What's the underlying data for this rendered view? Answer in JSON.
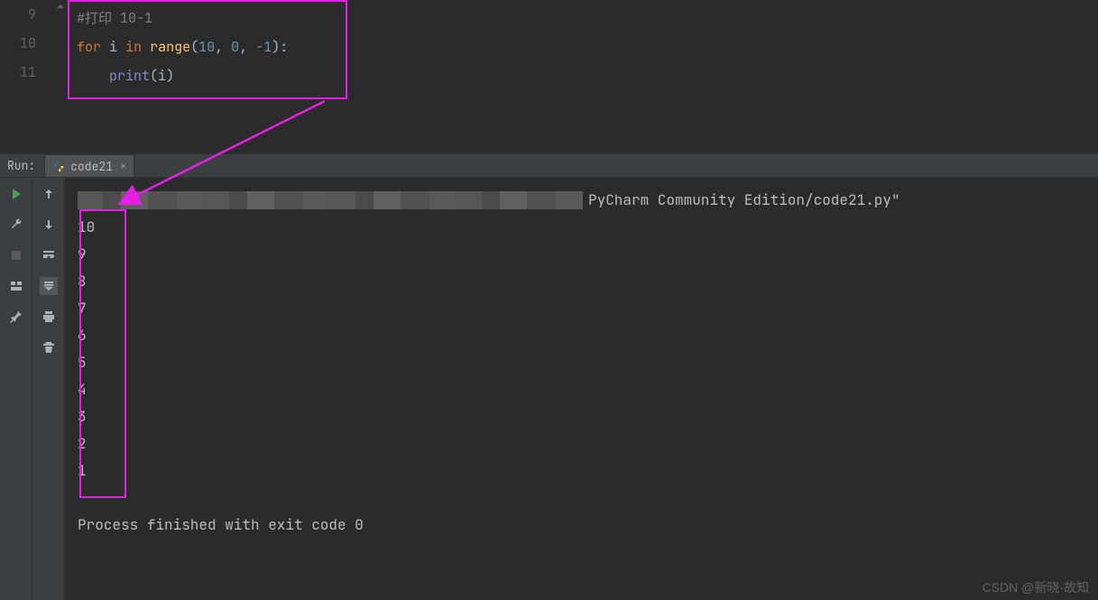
{
  "editor": {
    "line_numbers": [
      "9",
      "10",
      "11"
    ],
    "code": {
      "comment": "#打印 10-1",
      "kw_for": "for",
      "var_i": "i",
      "kw_in": "in",
      "fn_range": "range",
      "args_open": "(",
      "n1": "10",
      "comma1": ", ",
      "n2": "0",
      "comma2": ", ",
      "n3": "-1",
      "args_close": "):",
      "indent": "    ",
      "fn_print": "print",
      "pa_open": "(",
      "pvar": "i",
      "pa_close": ")"
    }
  },
  "run": {
    "label": "Run:",
    "tab_name": "code21",
    "cmd_tail": "PyCharm Community Edition/code21.py\"",
    "output": [
      "10",
      "9",
      "8",
      "7",
      "6",
      "5",
      "4",
      "3",
      "2",
      "1"
    ],
    "exit_msg": "Process finished with exit code 0"
  },
  "watermark": "CSDN @新晓·故知"
}
